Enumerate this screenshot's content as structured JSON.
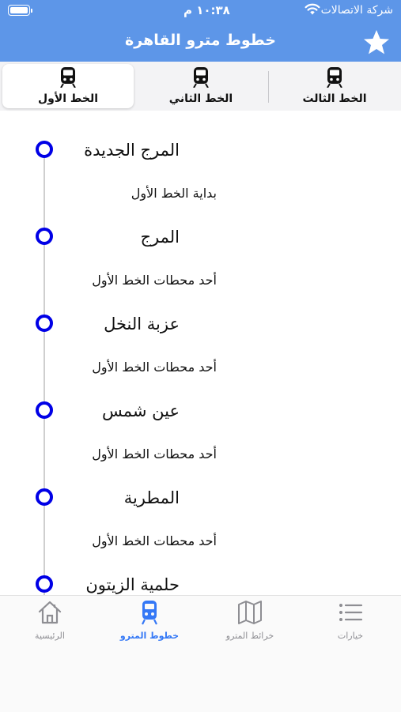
{
  "status_bar": {
    "carrier": "شركة الاتصالات",
    "time": "١٠:٣٨ م",
    "wifi_icon": "wifi-icon",
    "battery_icon": "battery-icon"
  },
  "nav": {
    "title": "خطوط مترو القاهرة",
    "favorite_icon": "star-icon"
  },
  "tabs": [
    {
      "label": "الخط الأول",
      "icon": "train-icon",
      "active": true
    },
    {
      "label": "الخط الثاني",
      "icon": "train-icon",
      "active": false
    },
    {
      "label": "الخط الثالث",
      "icon": "train-icon",
      "active": false
    }
  ],
  "stations": [
    {
      "name": "المرج الجديدة",
      "desc": "بداية الخط الأول"
    },
    {
      "name": "المرج",
      "desc": "أحد محطات الخط الأول"
    },
    {
      "name": "عزبة النخل",
      "desc": "أحد محطات الخط الأول"
    },
    {
      "name": "عين شمس",
      "desc": "أحد محطات الخط الأول"
    },
    {
      "name": "المطرية",
      "desc": "أحد محطات الخط الأول"
    },
    {
      "name": "حلمية الزيتون",
      "desc": ""
    }
  ],
  "tab_bar": [
    {
      "label": "الرئيسية",
      "icon": "home-icon",
      "active": false
    },
    {
      "label": "خطوط المترو",
      "icon": "train-icon",
      "active": true
    },
    {
      "label": "خرائط المترو",
      "icon": "map-icon",
      "active": false
    },
    {
      "label": "خيارات",
      "icon": "list-icon",
      "active": false
    }
  ],
  "colors": {
    "header": "#5d96e8",
    "station_dot": "#0000e6",
    "tab_active": "#3478f6",
    "tab_inactive": "#8e8e93"
  }
}
